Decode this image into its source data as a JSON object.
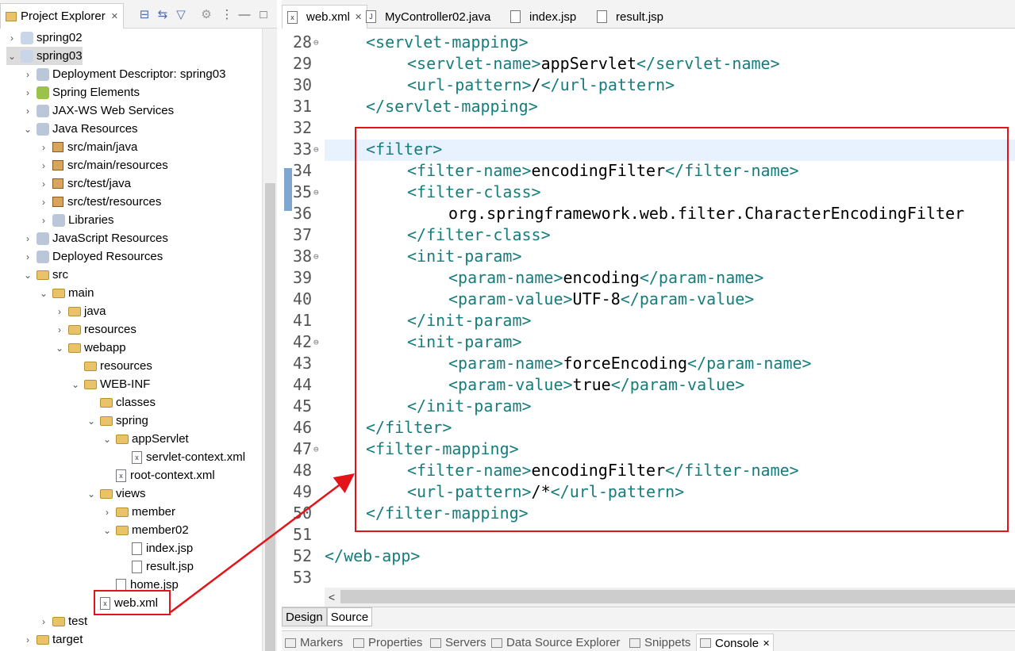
{
  "explorer": {
    "title": "Project Explorer",
    "close": "✕",
    "tree": [
      {
        "label": "spring02",
        "depth": 0,
        "twisty": ">",
        "icon": "project-icon"
      },
      {
        "label": "spring03",
        "depth": 0,
        "twisty": "v",
        "icon": "project-icon",
        "selected": true
      },
      {
        "label": "Deployment Descriptor: spring03",
        "depth": 1,
        "twisty": ">",
        "icon": "descriptor-icon"
      },
      {
        "label": "Spring Elements",
        "depth": 1,
        "twisty": ">",
        "icon": "spring-leaf-icon"
      },
      {
        "label": "JAX-WS Web Services",
        "depth": 1,
        "twisty": ">",
        "icon": "web-services-icon"
      },
      {
        "label": "Java Resources",
        "depth": 1,
        "twisty": "v",
        "icon": "java-resources-icon"
      },
      {
        "label": "src/main/java",
        "depth": 2,
        "twisty": ">",
        "icon": "package-folder-icon"
      },
      {
        "label": "src/main/resources",
        "depth": 2,
        "twisty": ">",
        "icon": "package-folder-icon"
      },
      {
        "label": "src/test/java",
        "depth": 2,
        "twisty": ">",
        "icon": "package-folder-icon"
      },
      {
        "label": "src/test/resources",
        "depth": 2,
        "twisty": ">",
        "icon": "package-folder-icon"
      },
      {
        "label": "Libraries",
        "depth": 2,
        "twisty": ">",
        "icon": "libraries-icon"
      },
      {
        "label": "JavaScript Resources",
        "depth": 1,
        "twisty": ">",
        "icon": "javascript-icon"
      },
      {
        "label": "Deployed Resources",
        "depth": 1,
        "twisty": ">",
        "icon": "deployed-icon"
      },
      {
        "label": "src",
        "depth": 1,
        "twisty": "v",
        "icon": "folder-icon"
      },
      {
        "label": "main",
        "depth": 2,
        "twisty": "v",
        "icon": "folder-icon"
      },
      {
        "label": "java",
        "depth": 3,
        "twisty": ">",
        "icon": "folder-icon"
      },
      {
        "label": "resources",
        "depth": 3,
        "twisty": ">",
        "icon": "folder-icon"
      },
      {
        "label": "webapp",
        "depth": 3,
        "twisty": "v",
        "icon": "folder-icon"
      },
      {
        "label": "resources",
        "depth": 4,
        "twisty": "",
        "icon": "folder-icon"
      },
      {
        "label": "WEB-INF",
        "depth": 4,
        "twisty": "v",
        "icon": "folder-icon"
      },
      {
        "label": "classes",
        "depth": 5,
        "twisty": "",
        "icon": "folder-icon"
      },
      {
        "label": "spring",
        "depth": 5,
        "twisty": "v",
        "icon": "folder-icon"
      },
      {
        "label": "appServlet",
        "depth": 6,
        "twisty": "v",
        "icon": "folder-icon"
      },
      {
        "label": "servlet-context.xml",
        "depth": 7,
        "twisty": "",
        "icon": "spring-xml-icon"
      },
      {
        "label": "root-context.xml",
        "depth": 6,
        "twisty": "",
        "icon": "spring-xml-icon"
      },
      {
        "label": "views",
        "depth": 5,
        "twisty": "v",
        "icon": "folder-icon"
      },
      {
        "label": "member",
        "depth": 6,
        "twisty": ">",
        "icon": "folder-icon"
      },
      {
        "label": "member02",
        "depth": 6,
        "twisty": "v",
        "icon": "folder-icon"
      },
      {
        "label": "index.jsp",
        "depth": 7,
        "twisty": "",
        "icon": "jsp-file-icon"
      },
      {
        "label": "result.jsp",
        "depth": 7,
        "twisty": "",
        "icon": "jsp-file-icon"
      },
      {
        "label": "home.jsp",
        "depth": 6,
        "twisty": "",
        "icon": "jsp-file-icon"
      },
      {
        "label": "web.xml",
        "depth": 5,
        "twisty": "",
        "icon": "xml-file-icon"
      },
      {
        "label": "test",
        "depth": 2,
        "twisty": ">",
        "icon": "folder-icon"
      },
      {
        "label": "target",
        "depth": 1,
        "twisty": ">",
        "icon": "folder-icon"
      }
    ]
  },
  "editor": {
    "tabs": [
      {
        "label": "web.xml",
        "icon": "xml-file-icon",
        "active": true,
        "close": "✕"
      },
      {
        "label": "MyController02.java",
        "icon": "java-file-icon",
        "active": false
      },
      {
        "label": "index.jsp",
        "icon": "jsp-file-icon",
        "active": false
      },
      {
        "label": "result.jsp",
        "icon": "jsp-file-icon",
        "active": false
      }
    ],
    "lines": [
      {
        "n": "28",
        "fold": true,
        "indent": 1,
        "parts": [
          [
            "t",
            "<servlet-mapping>"
          ]
        ]
      },
      {
        "n": "29",
        "fold": false,
        "indent": 2,
        "parts": [
          [
            "t",
            "<servlet-name>"
          ],
          [
            "x",
            "appServlet"
          ],
          [
            "t",
            "</servlet-name>"
          ]
        ]
      },
      {
        "n": "30",
        "fold": false,
        "indent": 2,
        "parts": [
          [
            "t",
            "<url-pattern>"
          ],
          [
            "x",
            "/"
          ],
          [
            "t",
            "</url-pattern>"
          ]
        ]
      },
      {
        "n": "31",
        "fold": false,
        "indent": 1,
        "parts": [
          [
            "t",
            "</servlet-mapping>"
          ]
        ]
      },
      {
        "n": "32",
        "fold": false,
        "indent": 0,
        "parts": []
      },
      {
        "n": "33",
        "fold": true,
        "indent": 1,
        "parts": [
          [
            "t",
            "<filter>"
          ]
        ],
        "current": true
      },
      {
        "n": "34",
        "fold": false,
        "indent": 2,
        "parts": [
          [
            "t",
            "<filter-name>"
          ],
          [
            "x",
            "encodingFilter"
          ],
          [
            "t",
            "</filter-name>"
          ]
        ]
      },
      {
        "n": "35",
        "fold": true,
        "indent": 2,
        "parts": [
          [
            "t",
            "<filter-class>"
          ]
        ]
      },
      {
        "n": "36",
        "fold": false,
        "indent": 3,
        "parts": [
          [
            "x",
            "org.springframework.web.filter.CharacterEncodingFilter"
          ]
        ]
      },
      {
        "n": "37",
        "fold": false,
        "indent": 2,
        "parts": [
          [
            "t",
            "</filter-class>"
          ]
        ]
      },
      {
        "n": "38",
        "fold": true,
        "indent": 2,
        "parts": [
          [
            "t",
            "<init-param>"
          ]
        ]
      },
      {
        "n": "39",
        "fold": false,
        "indent": 3,
        "parts": [
          [
            "t",
            "<param-name>"
          ],
          [
            "x",
            "encoding"
          ],
          [
            "t",
            "</param-name>"
          ]
        ]
      },
      {
        "n": "40",
        "fold": false,
        "indent": 3,
        "parts": [
          [
            "t",
            "<param-value>"
          ],
          [
            "x",
            "UTF-8"
          ],
          [
            "t",
            "</param-value>"
          ]
        ]
      },
      {
        "n": "41",
        "fold": false,
        "indent": 2,
        "parts": [
          [
            "t",
            "</init-param>"
          ]
        ]
      },
      {
        "n": "42",
        "fold": true,
        "indent": 2,
        "parts": [
          [
            "t",
            "<init-param>"
          ]
        ]
      },
      {
        "n": "43",
        "fold": false,
        "indent": 3,
        "parts": [
          [
            "t",
            "<param-name>"
          ],
          [
            "x",
            "forceEncoding"
          ],
          [
            "t",
            "</param-name>"
          ]
        ]
      },
      {
        "n": "44",
        "fold": false,
        "indent": 3,
        "parts": [
          [
            "t",
            "<param-value>"
          ],
          [
            "x",
            "true"
          ],
          [
            "t",
            "</param-value>"
          ]
        ]
      },
      {
        "n": "45",
        "fold": false,
        "indent": 2,
        "parts": [
          [
            "t",
            "</init-param>"
          ]
        ]
      },
      {
        "n": "46",
        "fold": false,
        "indent": 1,
        "parts": [
          [
            "t",
            "</filter>"
          ]
        ]
      },
      {
        "n": "47",
        "fold": true,
        "indent": 1,
        "parts": [
          [
            "t",
            "<filter-mapping>"
          ]
        ]
      },
      {
        "n": "48",
        "fold": false,
        "indent": 2,
        "parts": [
          [
            "t",
            "<filter-name>"
          ],
          [
            "x",
            "encodingFilter"
          ],
          [
            "t",
            "</filter-name>"
          ]
        ]
      },
      {
        "n": "49",
        "fold": false,
        "indent": 2,
        "parts": [
          [
            "t",
            "<url-pattern>"
          ],
          [
            "x",
            "/*"
          ],
          [
            "t",
            "</url-pattern>"
          ]
        ]
      },
      {
        "n": "50",
        "fold": false,
        "indent": 1,
        "parts": [
          [
            "t",
            "</filter-mapping>"
          ]
        ]
      },
      {
        "n": "51",
        "fold": false,
        "indent": 0,
        "parts": []
      },
      {
        "n": "52",
        "fold": false,
        "indent": 0,
        "parts": [
          [
            "t",
            "</web-app>"
          ]
        ]
      },
      {
        "n": "53",
        "fold": false,
        "indent": 0,
        "parts": []
      }
    ],
    "scroll_left": "<",
    "bottom_tabs": [
      {
        "label": "Design",
        "active": false
      },
      {
        "label": "Source",
        "active": true
      }
    ]
  },
  "views": [
    {
      "label": "Markers",
      "icon": "markers-icon",
      "active": false
    },
    {
      "label": "Properties",
      "icon": "properties-icon",
      "active": false
    },
    {
      "label": "Servers",
      "icon": "servers-icon",
      "active": false
    },
    {
      "label": "Data Source Explorer",
      "icon": "data-source-icon",
      "active": false
    },
    {
      "label": "Snippets",
      "icon": "snippets-icon",
      "active": false
    },
    {
      "label": "Console",
      "icon": "console-icon",
      "active": true,
      "close": "✕"
    }
  ],
  "colors": {
    "tag": "#177c7c",
    "annotation": "#e2141a",
    "current_line": "#e8f2fe"
  }
}
